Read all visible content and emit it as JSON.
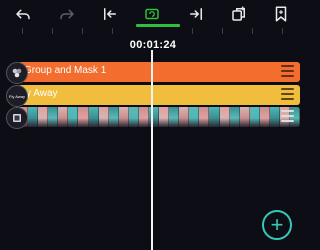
{
  "toolbar": {
    "icons": [
      "undo-icon",
      "redo-icon",
      "jump-start-icon",
      "loop-icon",
      "jump-end-icon",
      "duplicate-icon",
      "bookmark-icon"
    ],
    "active": "loop-icon",
    "accent": "#2fbf3a"
  },
  "timeline": {
    "timecode": "00:01:24"
  },
  "tracks": [
    {
      "label": "Group and Mask 1",
      "color": "#f36d2f"
    },
    {
      "label": "y Away",
      "color": "#f1bd3c",
      "avatar_text": "Fly Away"
    },
    {
      "label": "",
      "color": "#3a2f35"
    }
  ],
  "add_button": {
    "label": "+",
    "color": "#35c9b7"
  }
}
